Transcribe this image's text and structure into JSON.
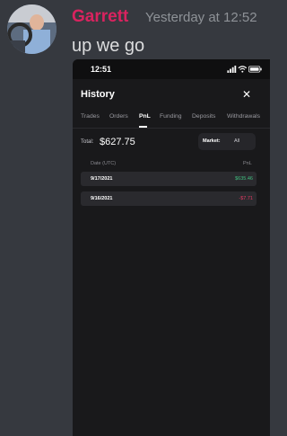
{
  "message": {
    "username": "Garrett",
    "timestamp": "Yesterday at 12:52",
    "text": "up we go",
    "username_color": "#d9235f"
  },
  "phone": {
    "status_time": "12:51",
    "history": {
      "title": "History",
      "close_icon": "close-icon",
      "tabs": [
        "Trades",
        "Orders",
        "PnL",
        "Funding",
        "Deposits",
        "Withdrawals"
      ],
      "active_tab": "PnL",
      "total_label": "Total:",
      "total_value": "$627.75",
      "market_label": "Market:",
      "market_value": "All",
      "columns": {
        "date": "Date (UTC)",
        "pnl": "PnL"
      },
      "rows": [
        {
          "date": "9/17/2021",
          "pnl": "$635.46"
        },
        {
          "date": "9/16/2021",
          "pnl": "-$7.71"
        }
      ],
      "positive_color": "#3fbf7f",
      "negative_color": "#e23a63"
    }
  }
}
